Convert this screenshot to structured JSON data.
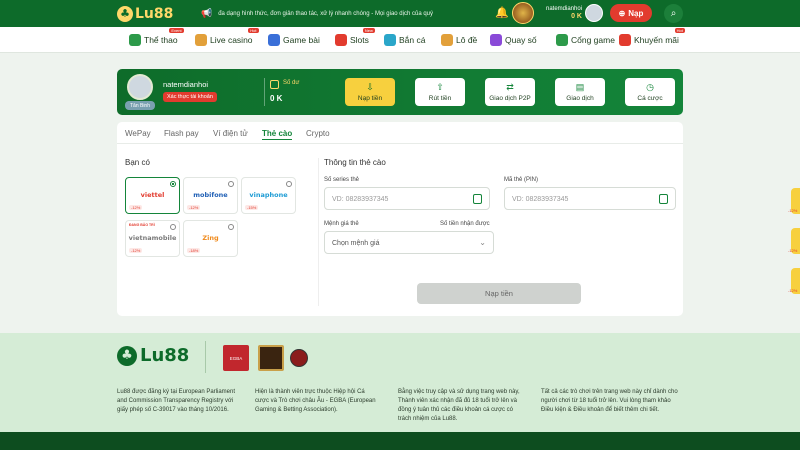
{
  "header": {
    "logo_text": "Lu88",
    "marquee": "đa dạng hình thức, đơn giản thao tác, xử lý nhanh chóng - Mọi giao dịch của quý",
    "username": "natemdianhoi",
    "balance": "0 K",
    "deposit_label": "Nạp"
  },
  "nav": [
    {
      "label": "Thể thao",
      "badge": "Event",
      "color": "#2d9a4a"
    },
    {
      "label": "Live casino",
      "badge": "Hot",
      "color": "#e2a03a"
    },
    {
      "label": "Game bài",
      "badge": "",
      "color": "#3a6fd8"
    },
    {
      "label": "Slots",
      "badge": "New",
      "color": "#e23b2e"
    },
    {
      "label": "Bắn cá",
      "badge": "",
      "color": "#2aa6c9"
    },
    {
      "label": "Lô đề",
      "badge": "",
      "color": "#e2a03a"
    },
    {
      "label": "Quay số",
      "badge": "",
      "color": "#8a4ad8"
    },
    {
      "label": "Cổng game",
      "badge": "",
      "color": "#2d9a4a"
    },
    {
      "label": "Khuyến mãi",
      "badge": "Hot",
      "color": "#e23b2e"
    }
  ],
  "account": {
    "username": "natemdianhoi",
    "rank": "Tân Binh",
    "verify_label": "Xác thực tài khoản",
    "balance_label": "Số dư",
    "balance": "0 K",
    "actions": [
      {
        "label": "Nạp tiền",
        "icon": "wallet-in-icon"
      },
      {
        "label": "Rút tiền",
        "icon": "wallet-out-icon"
      },
      {
        "label": "Giao dịch P2P",
        "icon": "exchange-icon"
      },
      {
        "label": "Giao dịch",
        "icon": "transactions-icon"
      },
      {
        "label": "Cá cược",
        "icon": "clock-icon"
      }
    ]
  },
  "tabs": [
    "WePay",
    "Flash pay",
    "Ví điện tử",
    "Thẻ cào",
    "Crypto"
  ],
  "providers_title": "Bạn có",
  "providers": [
    {
      "name": "viettel",
      "fee": "-12%",
      "color": "#e23b2e",
      "tag": "",
      "selected": true
    },
    {
      "name": "mobifone",
      "fee": "-12%",
      "color": "#1f5fb5",
      "tag": "",
      "selected": false
    },
    {
      "name": "vinaphone",
      "fee": "-15%",
      "color": "#1c9bd4",
      "tag": "",
      "selected": false
    },
    {
      "name": "vietnamobile",
      "fee": "-12%",
      "color": "#7a7a7a",
      "tag": "ĐANG BẢO TRÌ",
      "selected": false
    },
    {
      "name": "Zing",
      "fee": "-18%",
      "color": "#f08a1c",
      "tag": "",
      "selected": false
    }
  ],
  "form": {
    "title": "Thông tin thẻ cào",
    "serial_label": "Số series thẻ",
    "serial_placeholder": "VD: 08283937345",
    "pin_label": "Mã thẻ (PIN)",
    "pin_placeholder": "VD: 08283937345",
    "denom_label": "Mệnh giá thẻ",
    "denom_placeholder": "Chọn mệnh giá",
    "receive_label": "Số tiền nhận được",
    "submit_label": "Nạp tiền"
  },
  "footer": {
    "logo_text": "Lu88",
    "egba": "EGBA",
    "col1": "Lu88 được đăng ký tại European Parliament and Commission Transparency Registry với giấy phép số C-39017 vào tháng 10/2016.",
    "col2": "Hiện là thành viên trực thuộc Hiệp hội Cá cược và Trò chơi châu Âu - EGBA (European Gaming & Betting Association).",
    "col3": "Bằng việc truy cập và sử dụng trang web này, Thành viên xác nhận đã đủ 18 tuổi trở lên và đồng ý tuân thủ các điều khoản cá cược có trách nhiệm của Lu88.",
    "col4": "Tất cả các trò chơi trên trang web này chỉ dành cho người chơi từ 18 tuổi trở lên. Vui lòng tham khảo Điều kiện & Điều khoản để biết thêm chi tiết."
  },
  "side": [
    "-12%",
    "-12%",
    "-12%"
  ],
  "colors": {
    "brand_green": "#0d6b2a",
    "accent_yellow": "#f7d03e",
    "alert_red": "#e23b2e"
  }
}
